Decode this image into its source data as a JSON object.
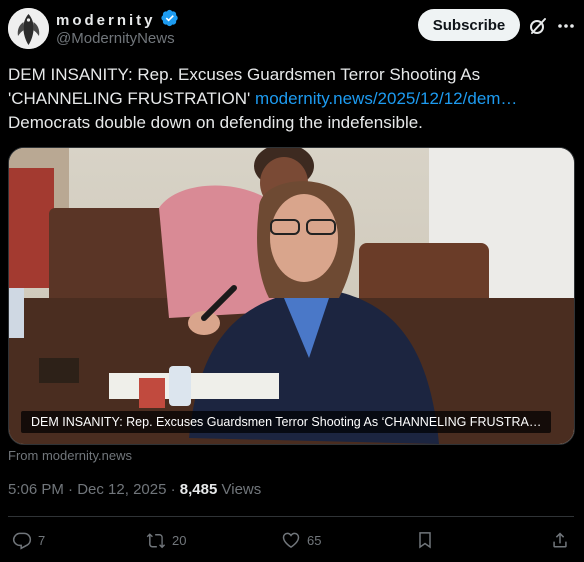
{
  "account": {
    "display_name": "modernity",
    "handle": "@ModernityNews",
    "verified": true,
    "verified_color": "#1d9bf0"
  },
  "header": {
    "subscribe_label": "Subscribe",
    "grok_icon": "grok-icon",
    "more_icon": "more-icon"
  },
  "post": {
    "text_line1": "DEM INSANITY: Rep. Excuses Guardsmen Terror Shooting As 'CHANNELING FRUSTRATION'",
    "link_text": "modernity.news/2025/12/12/dem…",
    "text_line2": "Democrats double down on defending the indefensible.",
    "link_color": "#1d9bf0"
  },
  "media": {
    "caption": "DEM INSANITY: Rep. Excuses Guardsmen Terror Shooting As ‘CHANNELING FRUSTRA…",
    "source": "From modernity.news"
  },
  "meta": {
    "time": "5:06 PM",
    "date": "Dec 12, 2025",
    "views_count": "8,485",
    "views_label": "Views"
  },
  "actions": {
    "replies": "7",
    "reposts": "20",
    "likes": "65"
  }
}
